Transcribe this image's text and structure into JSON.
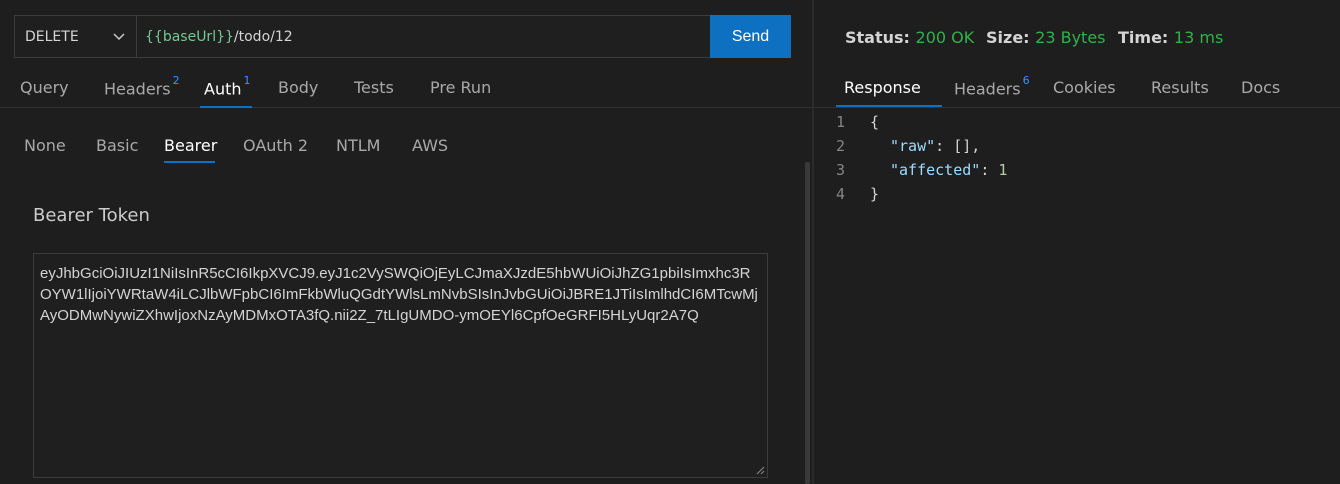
{
  "request": {
    "method": "DELETE",
    "url_var": "{{baseUrl}}",
    "url_path": "/todo/12",
    "send_label": "Send"
  },
  "tabs": [
    {
      "label": "Query",
      "badge": ""
    },
    {
      "label": "Headers",
      "badge": "2"
    },
    {
      "label": "Auth",
      "badge": "1"
    },
    {
      "label": "Body",
      "badge": ""
    },
    {
      "label": "Tests",
      "badge": ""
    },
    {
      "label": "Pre Run",
      "badge": ""
    }
  ],
  "auth_tabs": [
    "None",
    "Basic",
    "Bearer",
    "OAuth 2",
    "NTLM",
    "AWS"
  ],
  "bearer": {
    "label": "Bearer Token",
    "token": "eyJhbGciOiJIUzI1NiIsInR5cCI6IkpXVCJ9.eyJ1c2VySWQiOjEyLCJmaXJzdE5hbWUiOiJhZG1pbiIsImxhc3ROYW1lIjoiYWRtaW4iLCJlbWFpbCI6ImFkbWluQGdtYWlsLmNvbSIsInJvbGUiOiJBRE1JTiIsImlhdCI6MTcwMjAyODMwNywiZXhwIjoxNzAyMDMxOTA3fQ.nii2Z_7tLIgUMDO-ymOEYl6CpfOeGRFI5HLyUqr2A7Q"
  },
  "status": {
    "status_label": "Status:",
    "status_value": "200 OK",
    "size_label": "Size:",
    "size_value": "23 Bytes",
    "time_label": "Time:",
    "time_value": "13 ms"
  },
  "response_tabs": [
    {
      "label": "Response",
      "badge": ""
    },
    {
      "label": "Headers",
      "badge": "6"
    },
    {
      "label": "Cookies",
      "badge": ""
    },
    {
      "label": "Results",
      "badge": ""
    },
    {
      "label": "Docs",
      "badge": ""
    }
  ],
  "response_body": {
    "line_numbers": [
      "1",
      "2",
      "3",
      "4"
    ],
    "open_brace": "{",
    "raw_key": "\"raw\"",
    "raw_value": "[]",
    "affected_key": "\"affected\"",
    "affected_value": "1",
    "close_brace": "}"
  },
  "colors": {
    "accent": "#0e70c0",
    "success": "#30b24a",
    "badge": "#3794ff"
  }
}
